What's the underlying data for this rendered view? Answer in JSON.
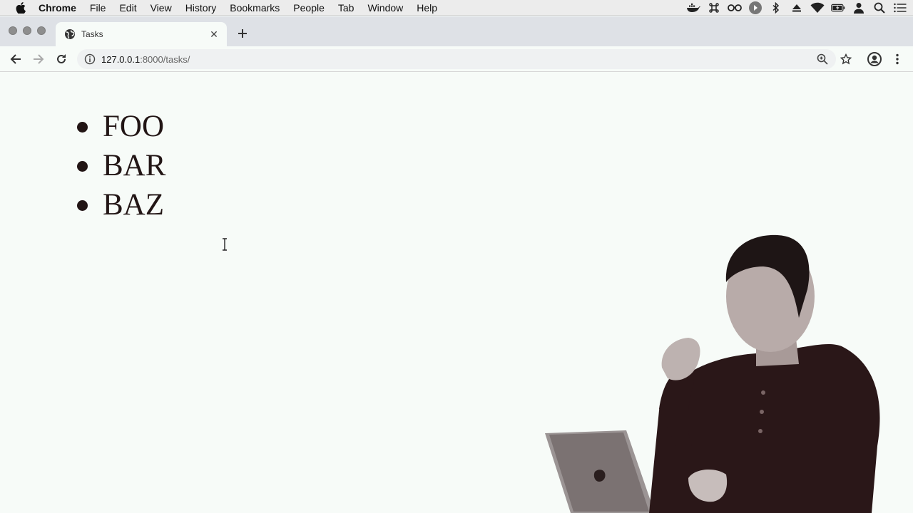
{
  "menubar": {
    "app_name": "Chrome",
    "items": [
      "File",
      "Edit",
      "View",
      "History",
      "Bookmarks",
      "People",
      "Tab",
      "Window",
      "Help"
    ],
    "status_icons": [
      "docker-icon",
      "command-icon",
      "glasses-icon",
      "play-icon",
      "bluetooth-icon",
      "eject-icon",
      "wifi-icon",
      "battery-icon",
      "user-icon",
      "spotlight-icon",
      "list-icon"
    ]
  },
  "tab": {
    "title": "Tasks",
    "close_glyph": "✕"
  },
  "toolbar": {
    "url_host": "127.0.0.1",
    "url_path": ":8000/tasks/"
  },
  "page": {
    "tasks": [
      "FOO",
      "BAR",
      "BAZ"
    ]
  },
  "colors": {
    "page_background": "#f7fbf8",
    "text": "#221515",
    "tabstrip": "#dee1e6"
  }
}
